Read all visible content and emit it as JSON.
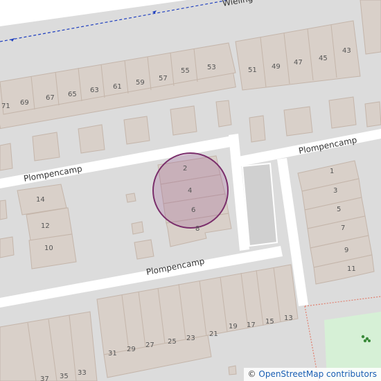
{
  "map": {
    "streets": [
      {
        "id": "plompencamp-west",
        "name": "Plompencamp"
      },
      {
        "id": "plompencamp-east",
        "name": "Plompencamp"
      },
      {
        "id": "plompencamp-south",
        "name": "Plompencamp"
      },
      {
        "id": "wieling",
        "name": "Wieling"
      }
    ],
    "house_numbers": {
      "north_row": [
        "71",
        "69",
        "67",
        "65",
        "63",
        "61",
        "59",
        "57",
        "55",
        "53",
        "51",
        "49",
        "47",
        "45",
        "43"
      ],
      "center_block": [
        "2",
        "4",
        "6",
        "8"
      ],
      "west_block": [
        "14",
        "12",
        "10"
      ],
      "east_block": [
        "1",
        "3",
        "5",
        "7",
        "9",
        "11"
      ],
      "south_row": [
        "37",
        "35",
        "33",
        "31",
        "29",
        "27",
        "25",
        "23",
        "21",
        "19",
        "17",
        "15",
        "13"
      ]
    },
    "highlight": {
      "color": "#7a2e6b",
      "fill": "rgba(150,80,140,0.25)"
    },
    "colors": {
      "background": "#dcdcdc",
      "road": "#ffffff",
      "building": "#d9d0c9",
      "building_outline": "#c4b5aa",
      "path": "#1f3fbf",
      "park": "#d6f0d6",
      "park_border": "#e08070"
    },
    "park_icon": "tree-icon"
  },
  "attribution": {
    "symbol": "©",
    "text": "OpenStreetMap contributors"
  }
}
